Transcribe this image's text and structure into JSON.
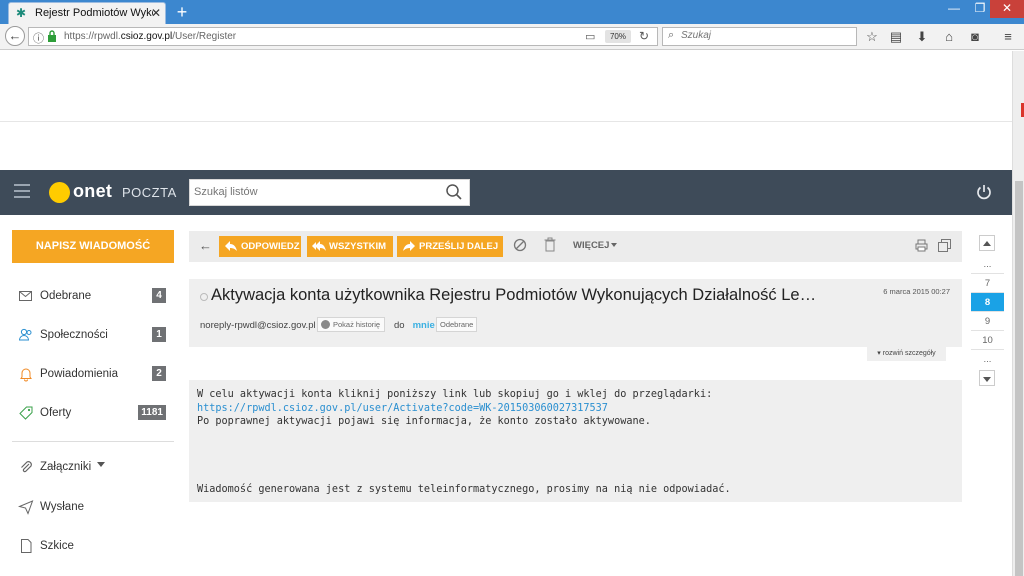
{
  "browser": {
    "tab_title": "Rejestr Podmiotów Wykonu",
    "url_prefix": "https://rpwdl.",
    "url_domain": "csioz.gov.pl",
    "url_path": "/User/Register",
    "zoom": "70%",
    "search_placeholder": "Szukaj"
  },
  "header": {
    "logo_word": "onet",
    "logo_sub": "POCZTA",
    "search_placeholder": "Szukaj listów"
  },
  "sidebar": {
    "compose_label": "NAPISZ WIADOMOŚĆ",
    "items": [
      {
        "label": "Odebrane",
        "count": "4",
        "icon": "inbox-icon"
      },
      {
        "label": "Społeczności",
        "count": "1",
        "icon": "users-icon"
      },
      {
        "label": "Powiadomienia",
        "count": "2",
        "icon": "bell-icon"
      },
      {
        "label": "Oferty",
        "count": "1181",
        "icon": "tag-icon"
      },
      {
        "label": "Załączniki",
        "icon": "paperclip-icon"
      },
      {
        "label": "Wysłane",
        "icon": "send-icon"
      },
      {
        "label": "Szkice",
        "icon": "draft-icon"
      }
    ]
  },
  "toolbar": {
    "reply": "ODPOWIEDZ",
    "reply_all": "WSZYSTKIM",
    "forward": "PRZEŚLIJ DALEJ",
    "more": "WIĘCEJ"
  },
  "message": {
    "subject": "Aktywacja konta użytkownika Rejestru Podmiotów Wykonujących Działalność Le…",
    "date": "6 marca 2015 00:27",
    "from": "noreply-rpwdl@csioz.gov.pl",
    "history_label": "Pokaż historię",
    "to_label": "do",
    "to_value": "mnie",
    "folder": "Odebrane",
    "details_toggle": "rozwiń szczegóły",
    "body_line1": "W celu aktywacji konta kliknij poniższy link lub skopiuj go i wklej do przeglądarki:",
    "body_link": "https://rpwdl.csioz.gov.pl/user/Activate?code=WK-201503060027317537",
    "body_line3": "Po poprawnej aktywacji pojawi się informacja, że konto zostało aktywowane.",
    "body_footer": "Wiadomość generowana jest z systemu teleinformatycznego, prosimy na nią nie odpowiadać."
  },
  "pager": {
    "items": [
      "...",
      "7",
      "8",
      "9",
      "10",
      "..."
    ],
    "active": "8"
  },
  "colors": {
    "accent": "#f5a623",
    "header_bg": "#3e4b59",
    "link": "#2a8fd0",
    "active_page": "#1aa2e6"
  }
}
